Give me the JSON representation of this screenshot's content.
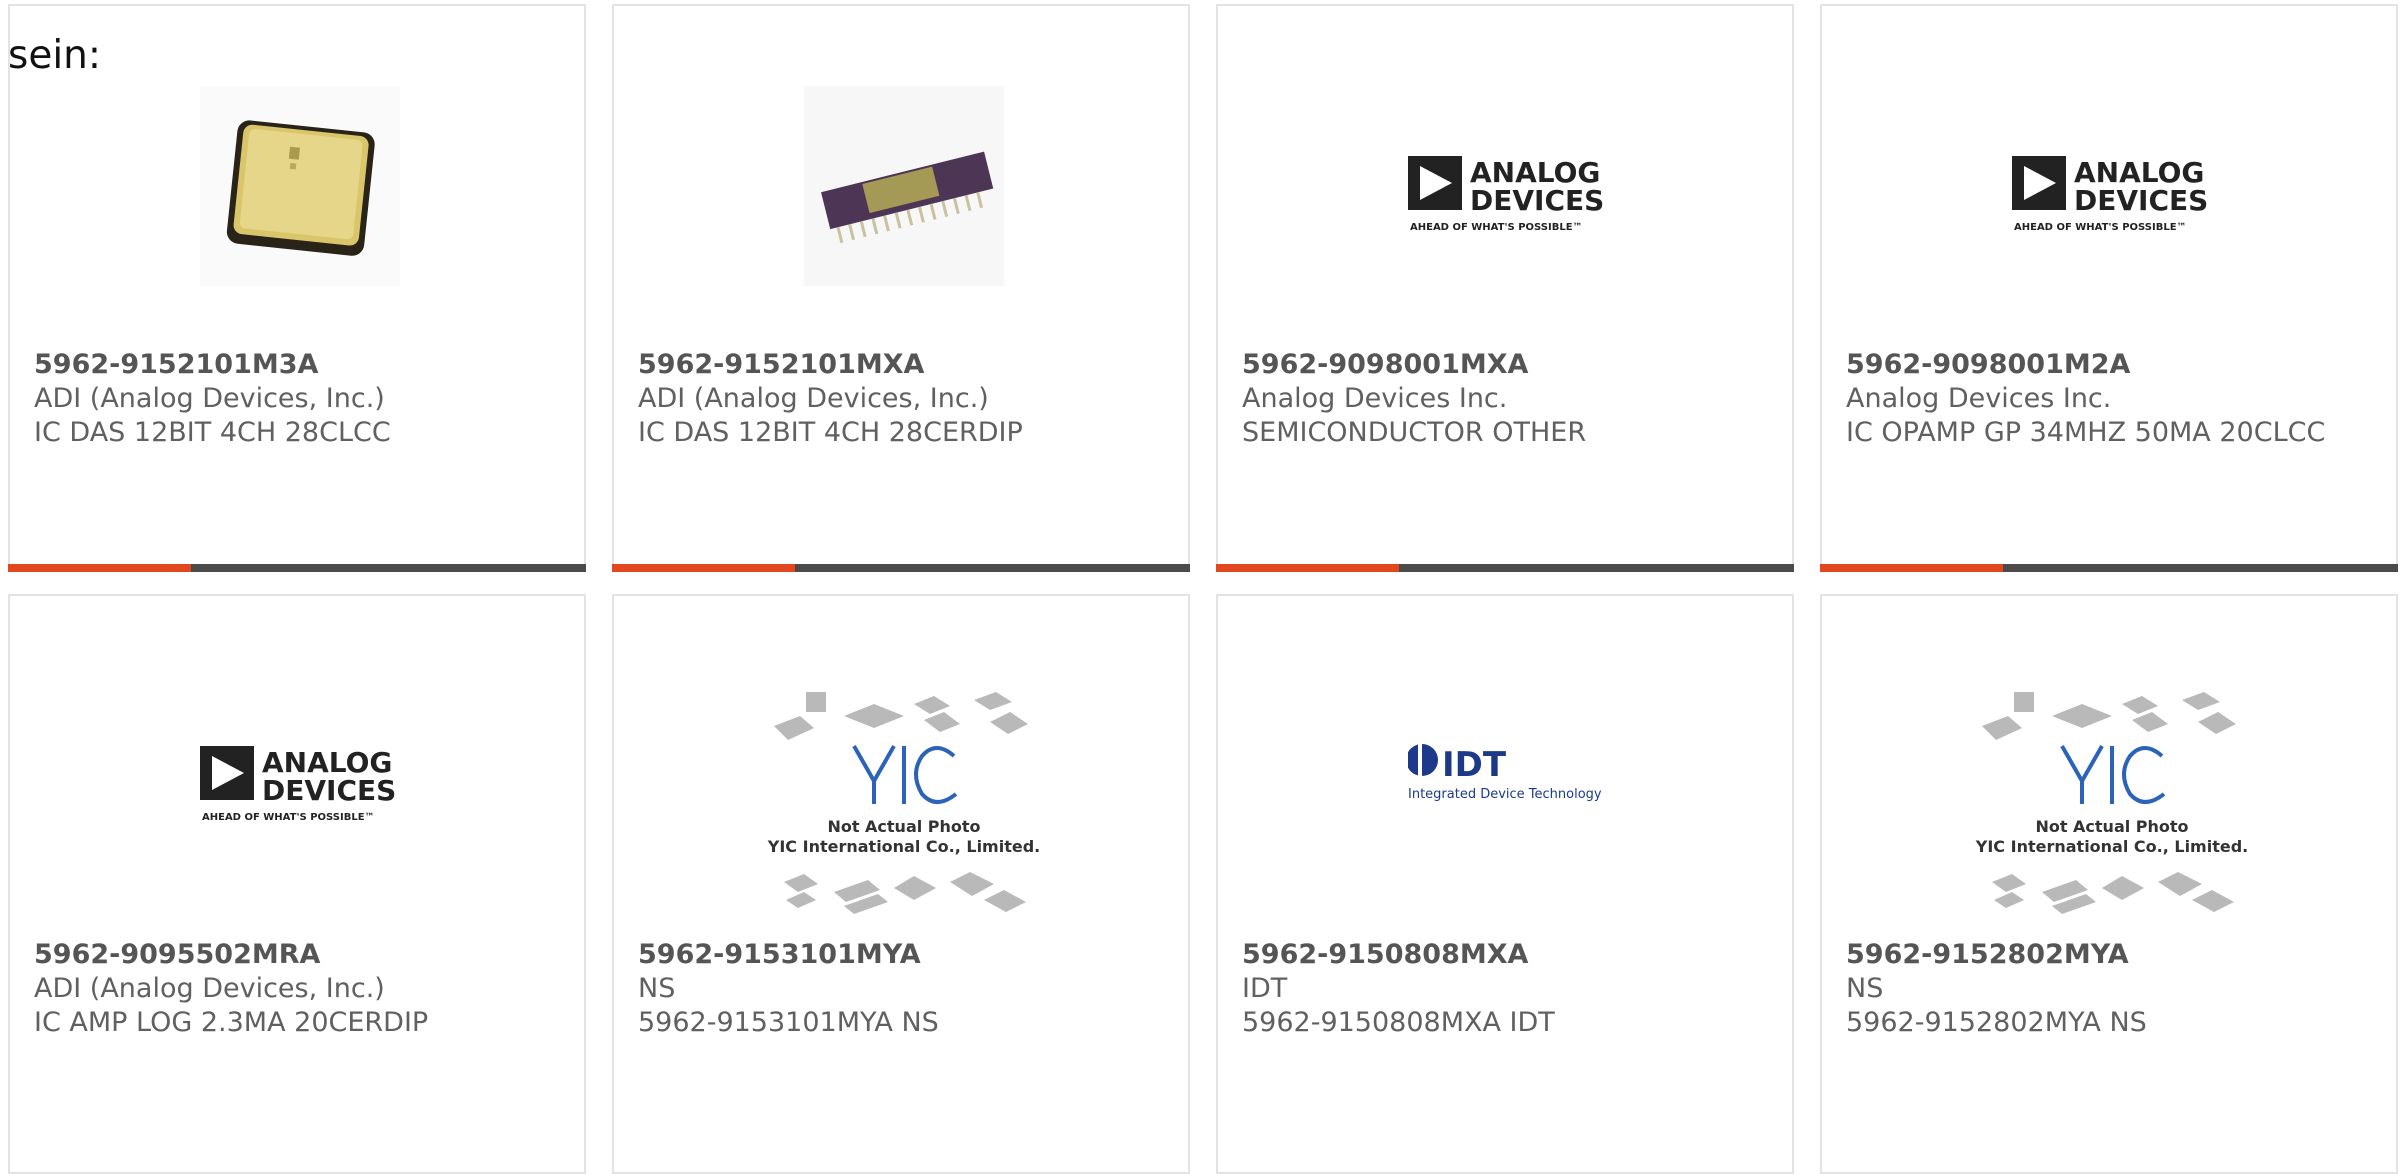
{
  "intro_text": "sein:",
  "products": [
    {
      "part_number": "5962-9152101M3A",
      "manufacturer": "ADI (Analog Devices, Inc.)",
      "description": "IC DAS 12BIT 4CH 28CLCC",
      "image": "gold-clcc-chip"
    },
    {
      "part_number": "5962-9152101MXA",
      "manufacturer": "ADI (Analog Devices, Inc.)",
      "description": "IC DAS 12BIT 4CH 28CERDIP",
      "image": "cerdip-chip"
    },
    {
      "part_number": "5962-9098001MXA",
      "manufacturer": "Analog Devices Inc.",
      "description": "SEMICONDUCTOR OTHER",
      "image": "analog-devices-logo"
    },
    {
      "part_number": "5962-9098001M2A",
      "manufacturer": "Analog Devices Inc.",
      "description": "IC OPAMP GP 34MHZ 50MA 20CLCC",
      "image": "analog-devices-logo"
    },
    {
      "part_number": "5962-9095502MRA",
      "manufacturer": "ADI (Analog Devices, Inc.)",
      "description": "IC AMP LOG 2.3MA 20CERDIP",
      "image": "analog-devices-logo"
    },
    {
      "part_number": "5962-9153101MYA",
      "manufacturer": "NS",
      "description": "5962-9153101MYA NS",
      "image": "yic-placeholder"
    },
    {
      "part_number": "5962-9150808MXA",
      "manufacturer": "IDT",
      "description": "5962-9150808MXA IDT",
      "image": "idt-logo"
    },
    {
      "part_number": "5962-9152802MYA",
      "manufacturer": "NS",
      "description": "5962-9152802MYA NS",
      "image": "yic-placeholder"
    }
  ],
  "logo_text": {
    "analog_line1": "ANALOG",
    "analog_line2": "DEVICES",
    "analog_tagline": "AHEAD OF WHAT'S POSSIBLE™",
    "idt_name": "IDT",
    "idt_tagline": "Integrated Device Technology",
    "yic_line1": "Not Actual Photo",
    "yic_line2": "YIC International Co., Limited."
  },
  "colors": {
    "accent": "#e2471d",
    "bar_dark": "#4a4a4a",
    "border": "#e3e3e3",
    "text": "#606060"
  }
}
